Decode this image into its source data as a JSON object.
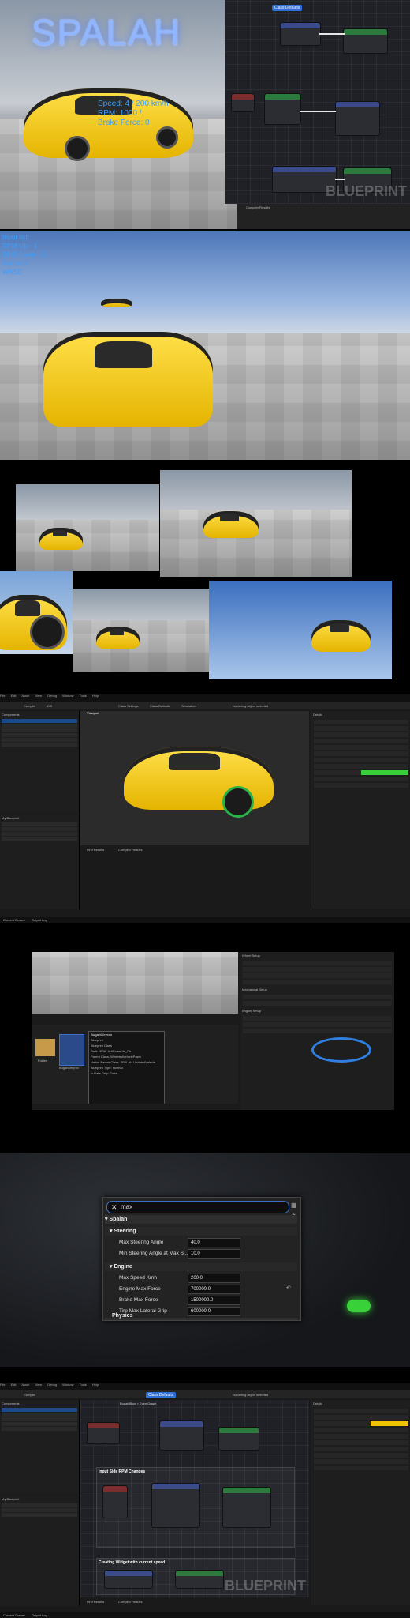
{
  "hero": {
    "logo": "SPALAH",
    "hud_lines": "Speed: 4 / 200 km/h\nRPM: 1000 /\nBrake Force: 0",
    "console_tab": "Compiler Results",
    "watermark": "BLUEPRINT"
  },
  "scene2": {
    "input_list": "Input list:\nRPM Up - 1\nRPM Down - 2\nControls:\nWASD"
  },
  "editor1": {
    "menu": [
      "File",
      "Edit",
      "Asset",
      "View",
      "Debug",
      "Window",
      "Tools",
      "Help"
    ],
    "asset_name": "BugattiBlue",
    "toolbar": [
      "Compile",
      "Diff",
      "Find",
      "Hide Unrelated",
      "Class Settings",
      "Class Defaults",
      "Simulation"
    ],
    "debug_filter": "No debug object selected",
    "components_title": "Components",
    "my_blueprint_title": "My Blueprint",
    "viewport_tab": "Viewport",
    "details_title": "Details",
    "bottom_tabs": [
      "Find Results",
      "Compiler Results"
    ],
    "status": [
      "Content Drawer",
      "Output Log",
      "Cmd"
    ]
  },
  "content_browser": {
    "asset_label": "BugattiVeyron",
    "folder_label": "Folder",
    "tooltip_lines": [
      "BugattiVeyron",
      "Blueprint",
      "Blueprint Class",
      "Path: /SPALAH/Example_Ch",
      "Parent Class: WheeledVehiclePawn",
      "Native Parent Class: SPALAH.UpdatedVehicle",
      "Blueprint Type: Normal",
      "Is Data Only: False",
      "Num Replicated Properties: 0"
    ],
    "details_sections": [
      "Wheel Setup",
      "Mechanical Setup",
      "Engine Setup"
    ],
    "dropdown_values": [
      "BugattiWheel",
      "BugattiWheel",
      "BugattiWheel",
      "BugattiWheel"
    ]
  },
  "details_popup": {
    "search_text": "max",
    "sections": {
      "top": "Spalah",
      "steering": "Steering",
      "engine": "Engine",
      "physics": "Physics"
    },
    "rows": [
      {
        "label": "Max Steering Angle",
        "value": "40.0"
      },
      {
        "label": "Min Steering Angle at Max S...",
        "value": "10.0"
      },
      {
        "label": "Max Speed Kmh",
        "value": "200.0"
      },
      {
        "label": "Engine Max Force",
        "value": "700000.0"
      },
      {
        "label": "Brake Max Force",
        "value": "1500000.0"
      },
      {
        "label": "Tire Max Lateral Grip",
        "value": "600000.0"
      }
    ]
  },
  "editor2": {
    "graph_tab": "EventGraph",
    "breadcrumb": "BugattiBlue > EventGraph",
    "comment1": "Input Side RPM Changes",
    "comment2": "Creating Widget with current speed",
    "watermark": "BLUEPRINT",
    "zoom": "Zoom -2"
  },
  "colors": {
    "accent": "#2f6fd6",
    "car": "#f2c300",
    "hud": "#3aa0ff",
    "green": "#38d13a"
  },
  "icons": [
    "close-icon",
    "grid-icon",
    "gear-icon",
    "chevron-down-icon",
    "chevron-right-icon",
    "reset-arrow-icon"
  ]
}
